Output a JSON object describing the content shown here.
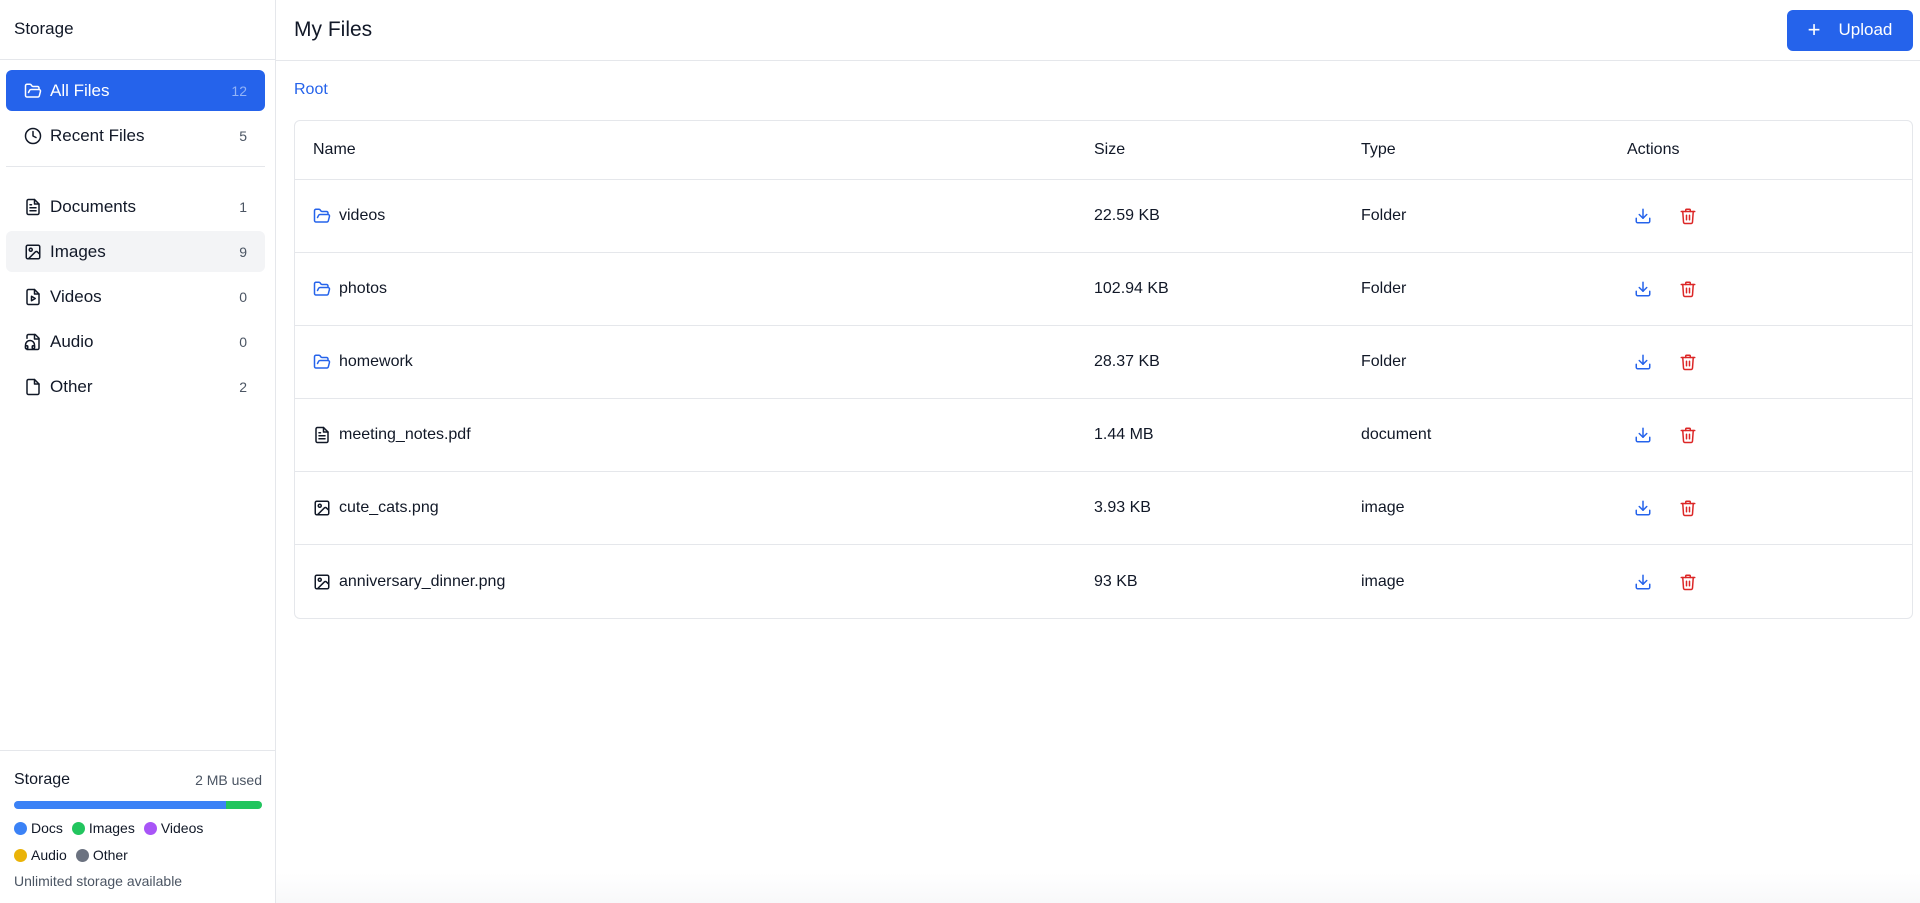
{
  "sidebar": {
    "title": "Storage",
    "nav": [
      {
        "label": "All Files",
        "count": "12",
        "icon": "folder-open-icon"
      },
      {
        "label": "Recent Files",
        "count": "5",
        "icon": "clock-icon"
      }
    ],
    "categories": [
      {
        "label": "Documents",
        "count": "1",
        "icon": "document-icon"
      },
      {
        "label": "Images",
        "count": "9",
        "icon": "image-icon"
      },
      {
        "label": "Videos",
        "count": "0",
        "icon": "video-file-icon"
      },
      {
        "label": "Audio",
        "count": "0",
        "icon": "audio-file-icon"
      },
      {
        "label": "Other",
        "count": "2",
        "icon": "file-icon"
      }
    ],
    "storage": {
      "title": "Storage",
      "used": "2 MB used",
      "docs_fraction": 0.855,
      "images_fraction": 0.145,
      "legend": [
        {
          "label": "Docs",
          "color": "#3b82f6"
        },
        {
          "label": "Images",
          "color": "#22c55e"
        },
        {
          "label": "Videos",
          "color": "#a855f7"
        },
        {
          "label": "Audio",
          "color": "#eab308"
        },
        {
          "label": "Other",
          "color": "#6b7280"
        }
      ],
      "note": "Unlimited storage available"
    }
  },
  "header": {
    "title": "My Files",
    "upload_label": "Upload"
  },
  "breadcrumb": {
    "root": "Root"
  },
  "table": {
    "columns": {
      "name": "Name",
      "size": "Size",
      "type": "Type",
      "actions": "Actions"
    },
    "rows": [
      {
        "name": "videos",
        "size": "22.59 KB",
        "type": "Folder",
        "icon": "folder-icon"
      },
      {
        "name": "photos",
        "size": "102.94 KB",
        "type": "Folder",
        "icon": "folder-icon"
      },
      {
        "name": "homework",
        "size": "28.37 KB",
        "type": "Folder",
        "icon": "folder-icon"
      },
      {
        "name": "meeting_notes.pdf",
        "size": "1.44 MB",
        "type": "document",
        "icon": "document-icon"
      },
      {
        "name": "cute_cats.png",
        "size": "3.93 KB",
        "type": "image",
        "icon": "image-icon"
      },
      {
        "name": "anniversary_dinner.png",
        "size": "93 KB",
        "type": "image",
        "icon": "image-icon"
      }
    ]
  },
  "colors": {
    "accent": "#2563eb",
    "danger": "#dc2626"
  }
}
